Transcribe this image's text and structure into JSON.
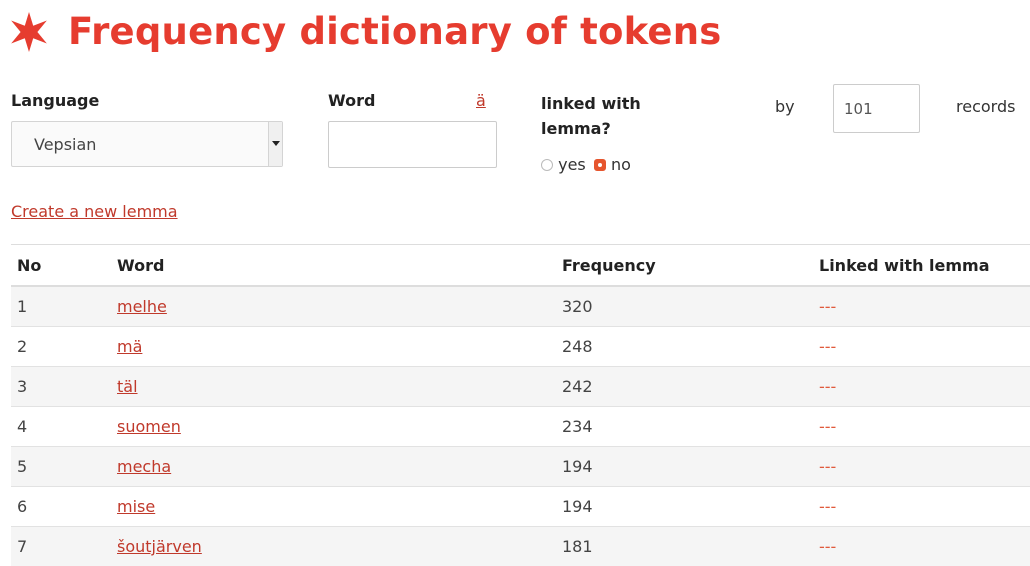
{
  "page": {
    "title": "Frequency dictionary of tokens"
  },
  "filters": {
    "language_label": "Language",
    "language_value": "Vepsian",
    "word_label": "Word",
    "special_char": "ä",
    "word_value": "",
    "linked_label_1": "linked with",
    "linked_label_2": "lemma?",
    "option_yes": "yes",
    "option_no": "no",
    "selected_option": "no",
    "by_label": "by",
    "records_value": "101",
    "records_label": "records"
  },
  "actions": {
    "create_lemma": "Create a new lemma"
  },
  "table": {
    "headers": [
      "No",
      "Word",
      "Frequency",
      "Linked with lemma"
    ],
    "rows": [
      {
        "no": "1",
        "word": "melhe",
        "frequency": "320",
        "linked": "---"
      },
      {
        "no": "2",
        "word": "mä",
        "frequency": "248",
        "linked": "---"
      },
      {
        "no": "3",
        "word": "täl",
        "frequency": "242",
        "linked": "---"
      },
      {
        "no": "4",
        "word": "suomen",
        "frequency": "234",
        "linked": "---"
      },
      {
        "no": "5",
        "word": "mecha",
        "frequency": "194",
        "linked": "---"
      },
      {
        "no": "6",
        "word": "mise",
        "frequency": "194",
        "linked": "---"
      },
      {
        "no": "7",
        "word": "šoutjärven",
        "frequency": "181",
        "linked": "---"
      }
    ]
  },
  "colors": {
    "accent": "#e63c2f",
    "link": "#c0392b"
  },
  "icons": {
    "title_icon": "asterisk-star-icon"
  }
}
